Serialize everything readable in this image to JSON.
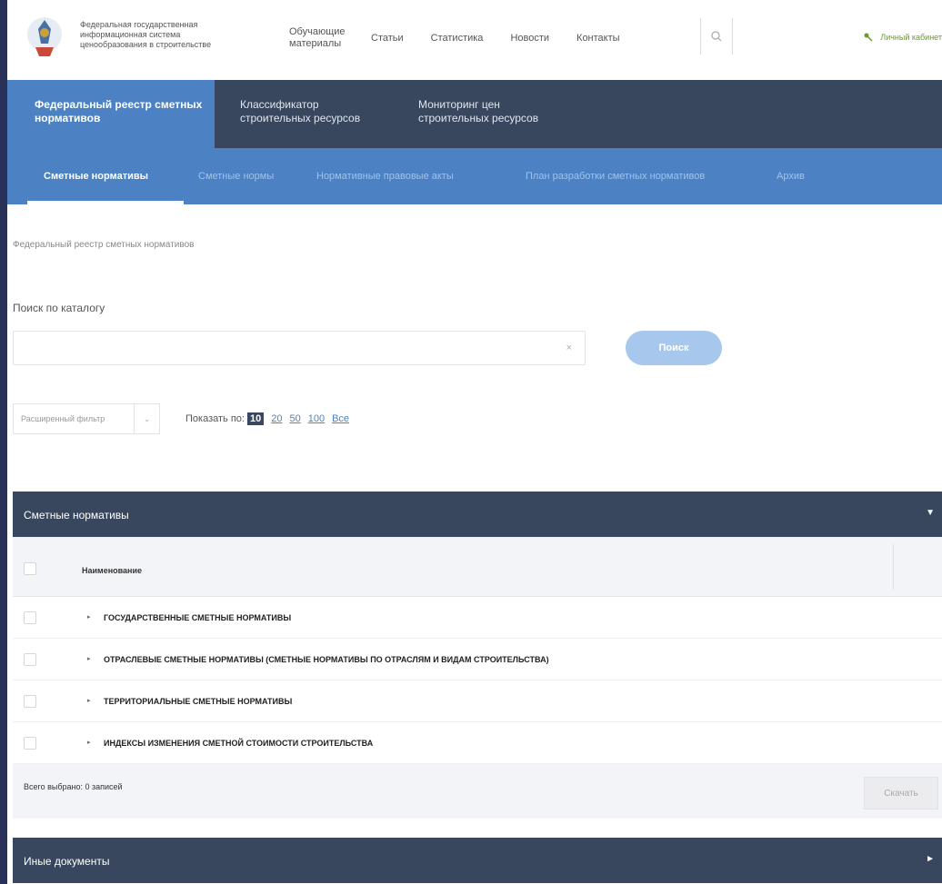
{
  "header": {
    "org_name": "Федеральная государственная информационная система ценообразования в строительстве",
    "nav": [
      "Обучающие материалы",
      "Статьи",
      "Статистика",
      "Новости",
      "Контакты"
    ],
    "cabinet": "Личный кабинет"
  },
  "main_menu": {
    "items": [
      "Федеральный реестр сметных нормативов",
      "Классификатор строительных ресурсов",
      "Мониторинг цен строительных ресурсов"
    ]
  },
  "sub_menu": {
    "items": [
      "Сметные нормативы",
      "Сметные нормы",
      "Нормативные правовые акты",
      "План разработки сметных нормативов",
      "Архив"
    ]
  },
  "breadcrumb": "Федеральный реестр сметных нормативов",
  "search": {
    "label": "Поиск по каталогу",
    "value": "",
    "clear": "×",
    "button": "Поиск"
  },
  "filter": {
    "label": "Расширенный фильтр",
    "chevron": "⌄"
  },
  "page_size": {
    "label": "Показать по:",
    "options": [
      "10",
      "20",
      "50",
      "100",
      "Все"
    ],
    "current": "10"
  },
  "section1": {
    "title": "Сметные нормативы",
    "toggle": "▼"
  },
  "table": {
    "column": "Наименование",
    "arrow": "▸",
    "rows": [
      "ГОСУДАРСТВЕННЫЕ СМЕТНЫЕ НОРМАТИВЫ",
      "ОТРАСЛЕВЫЕ СМЕТНЫЕ НОРМАТИВЫ (СМЕТНЫЕ НОРМАТИВЫ ПО ОТРАСЛЯМ И ВИДАМ СТРОИТЕЛЬСТВА)",
      "ТЕРРИТОРИАЛЬНЫЕ СМЕТНЫЕ НОРМАТИВЫ",
      "ИНДЕКСЫ ИЗМЕНЕНИЯ СМЕТНОЙ СТОИМОСТИ СТРОИТЕЛЬСТВА"
    ],
    "total": "Всего выбрано: 0 записей",
    "download": "Скачать"
  },
  "section2": {
    "title": "Иные документы",
    "toggle": "►"
  },
  "colors": {
    "accent": "#4c82c3",
    "dark": "#38475e",
    "frame": "#2a3158",
    "cabinet": "#6a9a2a"
  }
}
